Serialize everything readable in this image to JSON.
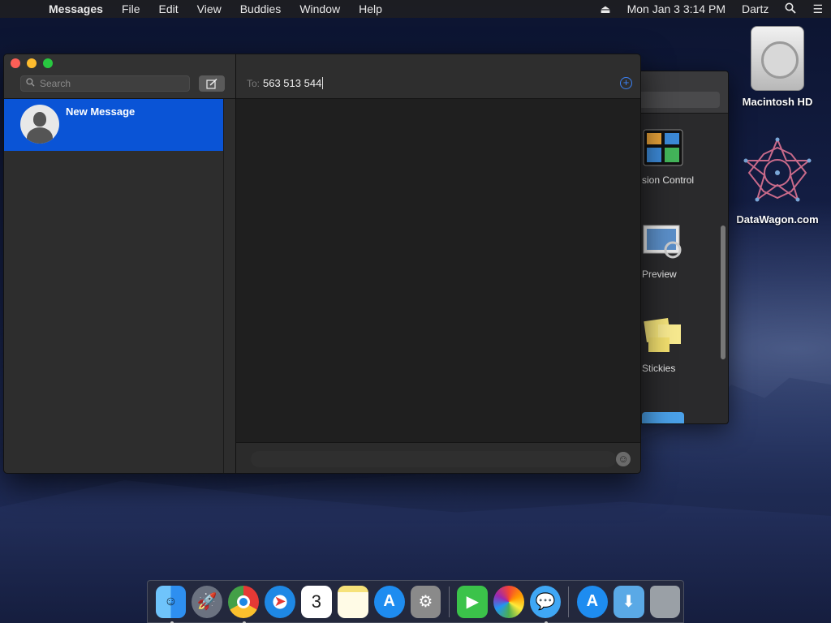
{
  "menubar": {
    "apple": "",
    "items": [
      "Messages",
      "File",
      "Edit",
      "View",
      "Buddies",
      "Window",
      "Help"
    ],
    "clock": "Mon Jan 3  3:14 PM",
    "user": "Dartz"
  },
  "desktop": {
    "icons": [
      {
        "label": "Macintosh HD"
      },
      {
        "label": "DataWagon.com"
      }
    ]
  },
  "finder_background": {
    "apps": [
      "sion Control",
      "Preview",
      "Stickies"
    ]
  },
  "messages": {
    "search_placeholder": "Search",
    "conversation": {
      "title": "New Message"
    },
    "to_label": "To:",
    "to_value": "563 513 544"
  },
  "dock": {
    "items": [
      {
        "name": "finder",
        "color": "#2e8ff0",
        "running": true
      },
      {
        "name": "launchpad",
        "color": "#6b7280",
        "running": false
      },
      {
        "name": "chrome",
        "color": "#ffffff",
        "running": true
      },
      {
        "name": "safari",
        "color": "#1e88e5",
        "running": false
      },
      {
        "name": "calendar",
        "color": "#ffffff",
        "running": false,
        "text": "3"
      },
      {
        "name": "notes",
        "color": "#f6e27a",
        "running": false
      },
      {
        "name": "app-store",
        "color": "#1e8cf0",
        "running": false
      },
      {
        "name": "system-preferences",
        "color": "#8a8a8a",
        "running": false
      },
      {
        "name": "facetime",
        "color": "#3bc34a",
        "running": false
      },
      {
        "name": "photos",
        "color": "#ffffff",
        "running": false
      },
      {
        "name": "messages",
        "color": "#3fa7f5",
        "running": true
      },
      {
        "name": "app-store-2",
        "color": "#1e8cf0",
        "running": false
      },
      {
        "name": "downloads-folder",
        "color": "#5aa9e6",
        "running": false
      },
      {
        "name": "trash",
        "color": "#9aa0a6",
        "running": false
      }
    ]
  }
}
